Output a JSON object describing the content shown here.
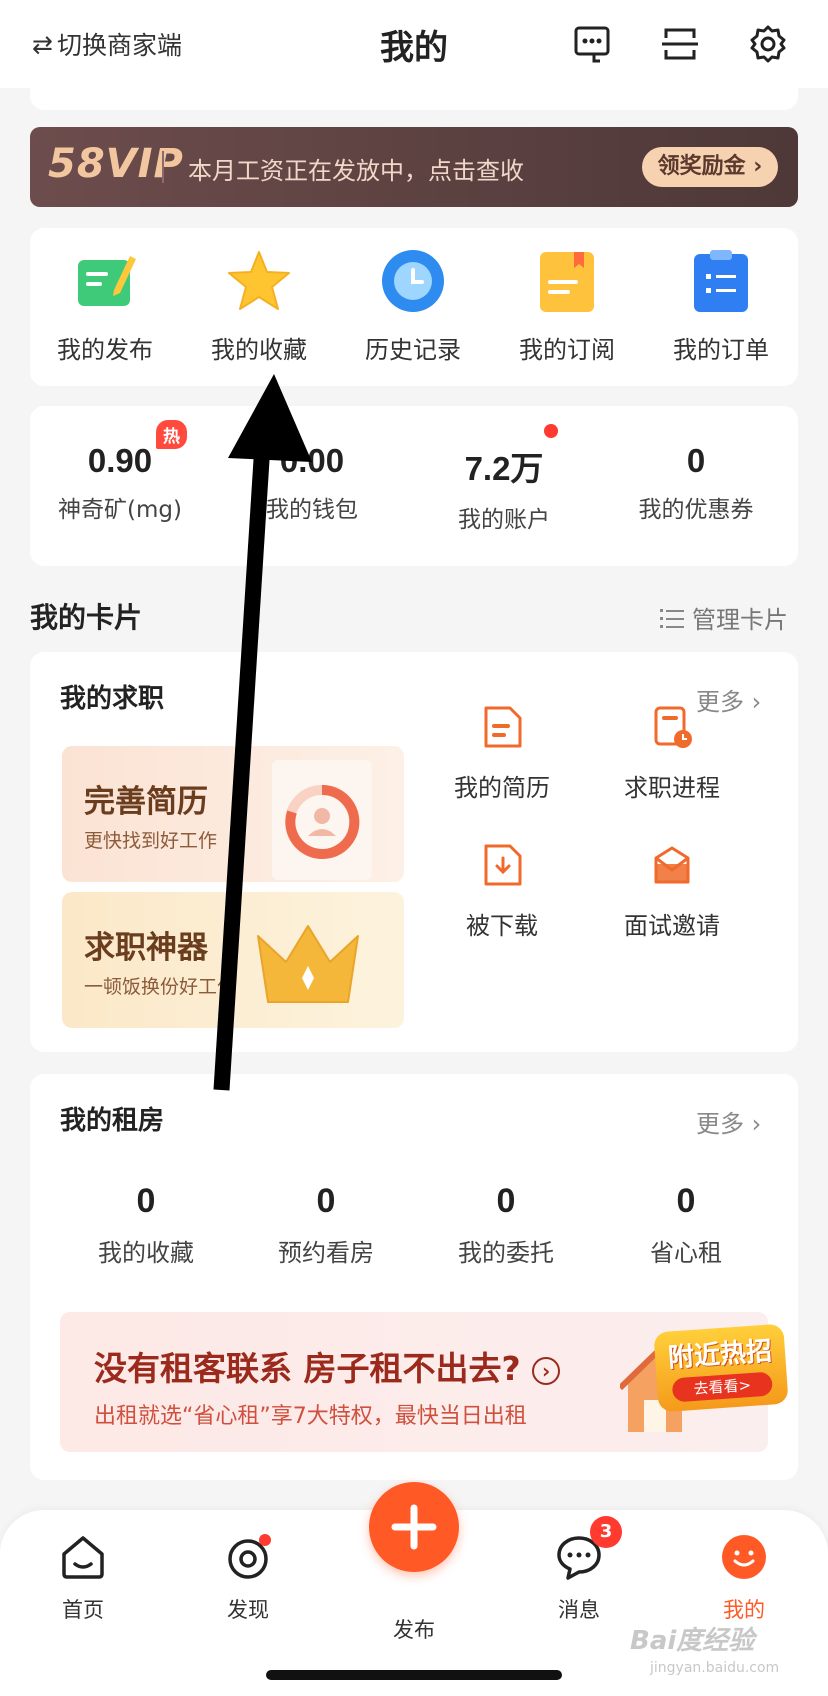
{
  "header": {
    "switch_label": "切换商家端",
    "title": "我的",
    "icons": [
      "customer-service-icon",
      "scan-icon",
      "settings-icon"
    ]
  },
  "vip": {
    "logo": "58VIP",
    "text": "本月工资正在发放中，点击查收",
    "button": "领奖励金 ›"
  },
  "shortcuts": [
    {
      "label": "我的发布",
      "icon": "publish-icon"
    },
    {
      "label": "我的收藏",
      "icon": "star-icon"
    },
    {
      "label": "历史记录",
      "icon": "clock-icon"
    },
    {
      "label": "我的订阅",
      "icon": "subscribe-icon"
    },
    {
      "label": "我的订单",
      "icon": "order-icon"
    }
  ],
  "stats": [
    {
      "value": "0.90",
      "label": "神奇矿(mg)",
      "tag": "热"
    },
    {
      "value": "0.00",
      "label": "我的钱包"
    },
    {
      "value": "7.2万",
      "label": "我的账户"
    },
    {
      "value": "0",
      "label": "我的优惠券"
    }
  ],
  "cards_section": {
    "title": "我的卡片",
    "manage": "管理卡片"
  },
  "job": {
    "title": "我的求职",
    "more": "更多 ›",
    "tiles": [
      {
        "title": "完善简历",
        "subtitle": "更快找到好工作"
      },
      {
        "title": "求职神器",
        "subtitle": "一顿饭换份好工作"
      }
    ],
    "items": [
      {
        "label": "我的简历",
        "icon": "resume-icon"
      },
      {
        "label": "求职进程",
        "icon": "progress-icon"
      },
      {
        "label": "被下载",
        "icon": "download-icon"
      },
      {
        "label": "面试邀请",
        "icon": "invite-icon"
      }
    ]
  },
  "rent": {
    "title": "我的租房",
    "more": "更多 ›",
    "stats": [
      {
        "value": "0",
        "label": "我的收藏"
      },
      {
        "value": "0",
        "label": "预约看房"
      },
      {
        "value": "0",
        "label": "我的委托"
      },
      {
        "value": "0",
        "label": "省心租"
      }
    ],
    "ad": {
      "title": "没有租客联系 房子租不出去?",
      "subtitle": "出租就选“省心租”享7大特权，最快当日出租",
      "badge_title": "附近热招",
      "badge_btn": "去看看>"
    }
  },
  "nav": {
    "items": [
      {
        "label": "首页",
        "icon": "home-icon"
      },
      {
        "label": "发现",
        "icon": "discover-icon"
      },
      {
        "label": "发布",
        "icon": "plus-icon"
      },
      {
        "label": "消息",
        "icon": "message-icon"
      },
      {
        "label": "我的",
        "icon": "profile-icon"
      }
    ],
    "message_badge": "3",
    "active": "我的"
  },
  "watermark": {
    "text": "Bai度经验",
    "url": "jingyan.baidu.com"
  },
  "colors": {
    "accent": "#ff5a26",
    "vip_bg": "#5c4242",
    "badge_red": "#ff3b30"
  }
}
